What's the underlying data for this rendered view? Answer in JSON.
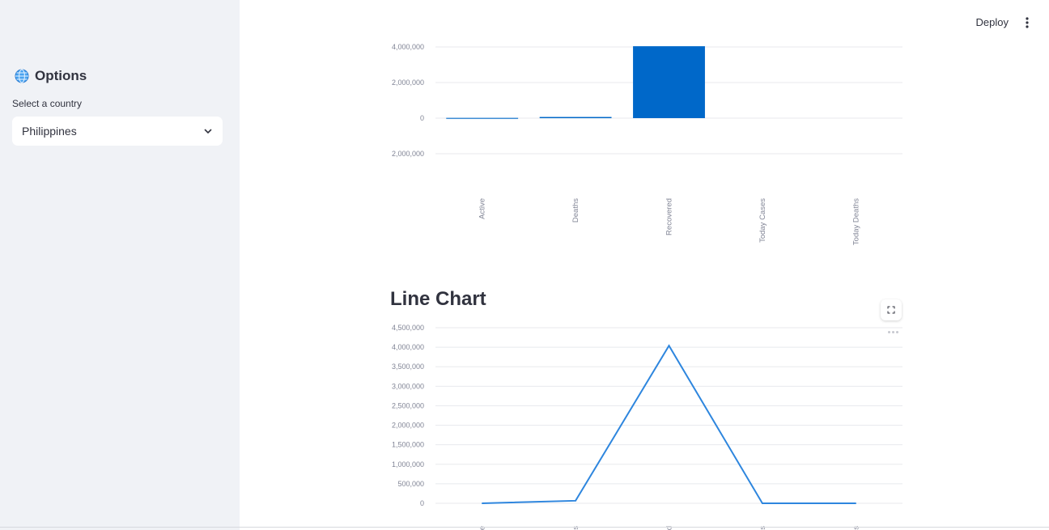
{
  "sidebar": {
    "title": "Options",
    "title_icon": "globe-icon",
    "select_label": "Select a country",
    "selected_country": "Philippines"
  },
  "header": {
    "deploy_label": "Deploy"
  },
  "colors": {
    "sidebar_bg": "#f0f2f6",
    "bar": "#0068c9",
    "line": "#2e86de",
    "text": "#31333f",
    "axis_text": "#808495"
  },
  "line_section": {
    "title": "Line Chart"
  },
  "chart_data": [
    {
      "type": "bar",
      "categories": [
        "Active",
        "Deaths",
        "Recovered",
        "Today Cases",
        "Today Deaths"
      ],
      "values": [
        20000,
        66000,
        4040000,
        0,
        0
      ],
      "ylim": [
        -2000000,
        4000000
      ],
      "yticks": [
        4000000,
        2000000,
        0,
        -2000000
      ],
      "ytick_labels": [
        "4,000,000",
        "2,000,000",
        "0",
        "2,000,000"
      ],
      "title": "",
      "xlabel": "",
      "ylabel": "",
      "grid": true
    },
    {
      "type": "line",
      "categories": [
        "Active",
        "Deaths",
        "Recovered",
        "Today Cases",
        "Today Deaths"
      ],
      "x_tick_labels": [
        "ive",
        "ths",
        "red",
        "ses",
        "ths"
      ],
      "values": [
        0,
        66000,
        4040000,
        0,
        0
      ],
      "ylim": [
        0,
        4500000
      ],
      "yticks": [
        0,
        500000,
        1000000,
        1500000,
        2000000,
        2500000,
        3000000,
        3500000,
        4000000,
        4500000
      ],
      "ytick_labels": [
        "0",
        "500,000",
        "1,000,000",
        "1,500,000",
        "2,000,000",
        "2,500,000",
        "3,000,000",
        "3,500,000",
        "4,000,000",
        "4,500,000"
      ],
      "title": "",
      "xlabel": "",
      "ylabel": "",
      "grid": true
    }
  ]
}
